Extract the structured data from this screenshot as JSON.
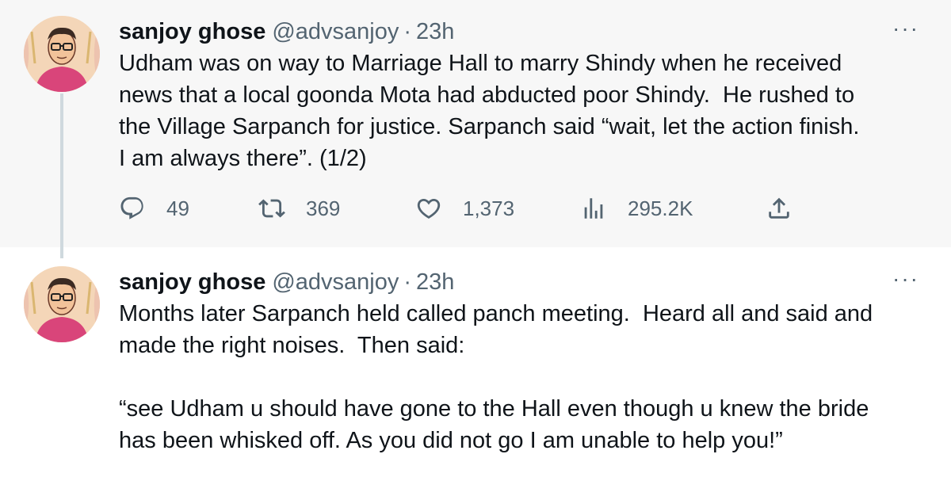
{
  "tweets": [
    {
      "name": "sanjoy ghose",
      "handle": "@advsanjoy",
      "separator": "·",
      "time": "23h",
      "more": "···",
      "text": "Udham was on way to Marriage Hall to marry Shindy when he received\nnews that a local goonda Mota had abducted poor Shindy.  He rushed to\nthe Village Sarpanch for justice. Sarpanch said “wait, let the action finish.\nI am always there”. (1/2)",
      "replies": "49",
      "retweets": "369",
      "likes": "1,373",
      "views": "295.2K"
    },
    {
      "name": "sanjoy ghose",
      "handle": "@advsanjoy",
      "separator": "·",
      "time": "23h",
      "more": "···",
      "text": "Months later Sarpanch held called panch meeting.  Heard all and said and\nmade the right noises.  Then said:\n\n“see Udham u should have gone to the Hall even though u knew the bride\nhas been whisked off. As you did not go I am unable to help you!”"
    }
  ],
  "icons": {
    "reply": "reply-icon",
    "retweet": "retweet-icon",
    "like": "heart-icon",
    "views": "views-icon",
    "share": "share-icon"
  },
  "colors": {
    "muted": "#536471",
    "text": "#0f1419",
    "thread_line": "#cfd9de",
    "highlight_bg": "#f7f7f7"
  }
}
